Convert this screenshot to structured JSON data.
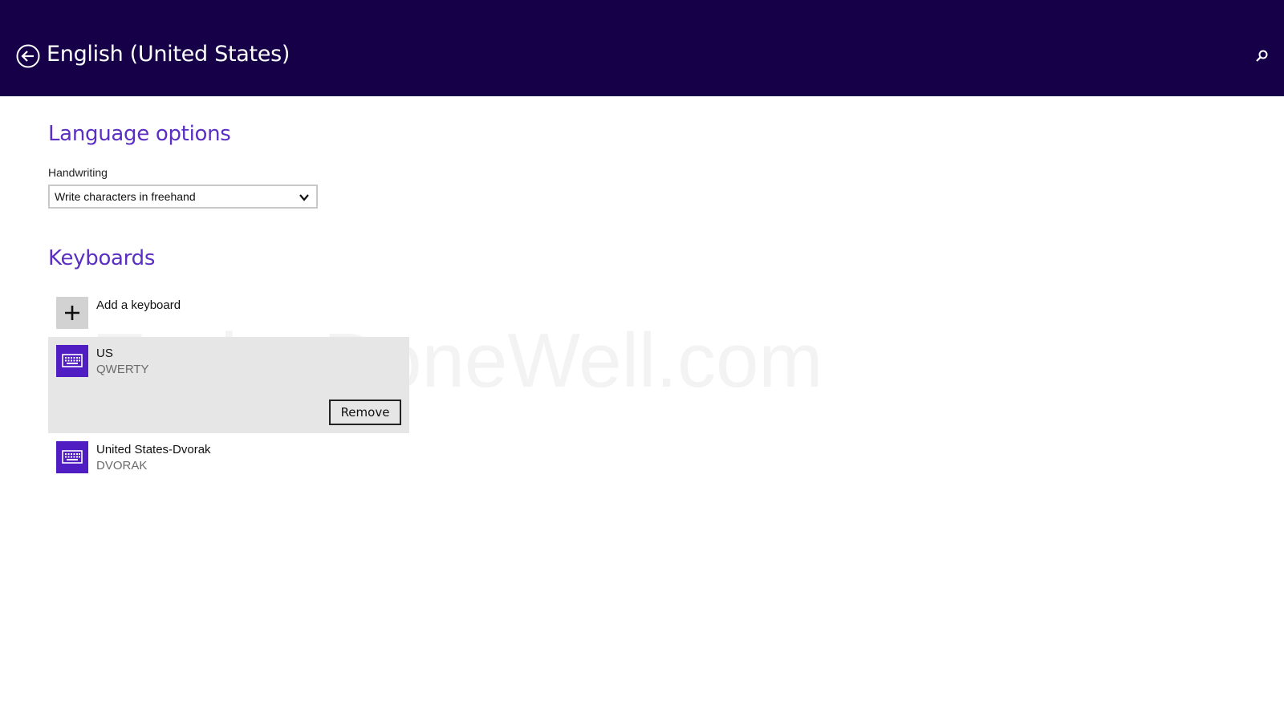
{
  "header": {
    "title": "English (United States)",
    "back_icon": "back-arrow-icon",
    "search_icon": "search-icon",
    "background_color": "#160048"
  },
  "watermark": "TypingDoneWell.com",
  "language_options": {
    "heading": "Language options",
    "handwriting": {
      "label": "Handwriting",
      "selected_value": "Write characters in freehand"
    }
  },
  "keyboards": {
    "heading": "Keyboards",
    "add_label": "Add a keyboard",
    "remove_label": "Remove",
    "items": [
      {
        "name": "US",
        "layout": "QWERTY",
        "selected": true
      },
      {
        "name": "United States-Dvorak",
        "layout": "DVORAK",
        "selected": false
      }
    ]
  },
  "colors": {
    "accent": "#5a2fc2",
    "tile": "#4f1dc2",
    "selected_bg": "#e6e6e6"
  }
}
